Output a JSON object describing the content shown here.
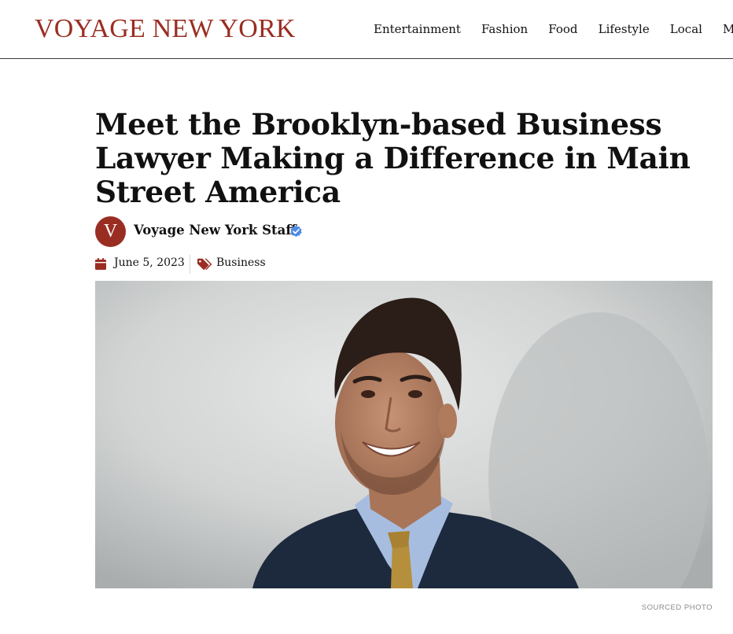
{
  "site": {
    "logo_text": "VOYAGE NEW YORK",
    "brand_color": "#9a2d22"
  },
  "nav": {
    "items": [
      {
        "label": "Entertainment"
      },
      {
        "label": "Fashion"
      },
      {
        "label": "Food"
      },
      {
        "label": "Lifestyle"
      },
      {
        "label": "Local"
      },
      {
        "label": "Moc"
      }
    ]
  },
  "article": {
    "title": "Meet the Brooklyn-based Business Lawyer Making a Difference in Main Street America",
    "author": {
      "avatar_letter": "V",
      "name": "Voyage New York Staff",
      "verified_icon": "verified-check-icon"
    },
    "meta": {
      "date": "June 5, 2023",
      "date_icon": "calendar-icon",
      "category": "Business",
      "category_icon": "tags-icon"
    },
    "image": {
      "subject": "portrait",
      "caption": "SOURCED PHOTO"
    }
  }
}
